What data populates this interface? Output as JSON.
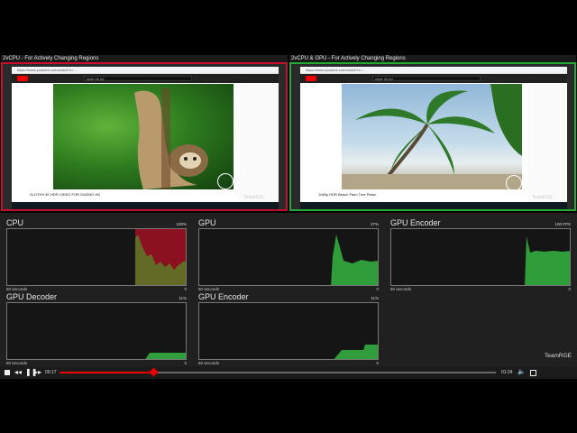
{
  "panes": {
    "left": {
      "title": "2vCPU - For Actively Changing Regions",
      "search_text": "sloth 4k hd",
      "caption": "SLOTHS 4K HDR VIDEO FOR GAZING HD",
      "watermark": "TeamRGE",
      "url": "https://www.youtube.com/watch?v=..."
    },
    "right": {
      "title": "2vCPU & GPU - For Actively Changing Regions",
      "search_text": "relax 4k hd",
      "caption": "1080p HDR Beach Palm Tree Relax",
      "watermark": "TeamRGE",
      "url": "https://www.youtube.com/watch?v=..."
    }
  },
  "stats": {
    "cpu": {
      "label": "CPU",
      "pct": "100%",
      "xlabel": "60 seconds",
      "xend": "0",
      "color": "#c8102e"
    },
    "gpu": {
      "label": "GPU",
      "pct": "27%",
      "xlabel": "60 seconds",
      "xend": "0",
      "color": "#2f9e3a"
    },
    "gpu_encoder_top": {
      "label": "GPU Encoder",
      "pct": "100 FPS",
      "xlabel": "60 seconds",
      "xend": "0",
      "color": "#2f9e3a"
    },
    "gpu_decoder": {
      "label": "GPU Decoder",
      "pct": "11%",
      "xlabel": "60 seconds",
      "xend": "0",
      "color": "#2f9e3a"
    },
    "gpu_encoder_bottom": {
      "label": "GPU Encoder",
      "pct": "11%",
      "xlabel": "60 seconds",
      "xend": "0",
      "color": "#2f9e3a"
    },
    "watermark": "TeamRGE"
  },
  "player": {
    "current_time": "00:17",
    "total_time": "01:24",
    "progress": 0.215
  }
}
